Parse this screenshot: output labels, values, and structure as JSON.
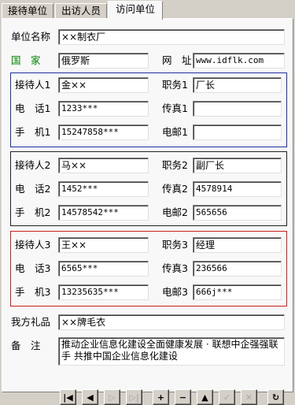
{
  "tabs": [
    {
      "label": "接待单位",
      "active": false
    },
    {
      "label": "出访人员",
      "active": false
    },
    {
      "label": "访问单位",
      "active": true
    }
  ],
  "form": {
    "unit_name": {
      "label": "单位名称",
      "value": "××制衣厂"
    },
    "country": {
      "label": "国　家",
      "value": "俄罗斯"
    },
    "website": {
      "label": "网　址",
      "value": "www.idflk.com"
    },
    "contacts": [
      {
        "name_label": "接待人1",
        "name": "金××",
        "title_label": "职务1",
        "title": "厂长",
        "phone_label": "电　话1",
        "phone": "1233***",
        "fax_label": "传真1",
        "fax": "",
        "mobile_label": "手　机1",
        "mobile": "15247858***",
        "email_label": "电邮1",
        "email": ""
      },
      {
        "name_label": "接待人2",
        "name": "马××",
        "title_label": "职务2",
        "title": "副厂长",
        "phone_label": "电　话2",
        "phone": "1452***",
        "fax_label": "传真2",
        "fax": "4578914",
        "mobile_label": "手　机2",
        "mobile": "14578542***",
        "email_label": "电邮2",
        "email": "565656"
      },
      {
        "name_label": "接待人3",
        "name": "王××",
        "title_label": "职务3",
        "title": "经理",
        "phone_label": "电　话3",
        "phone": "6565***",
        "fax_label": "传真3",
        "fax": "236566",
        "mobile_label": "手　机3",
        "mobile": "13235635***",
        "email_label": "电邮3",
        "email": "666j***"
      }
    ],
    "gift": {
      "label": "我方礼品",
      "value": "××牌毛衣"
    },
    "remark": {
      "label": "备　注",
      "value": "推动企业信息化建设全面健康发展 · 联想中企强强联手 共推中国企业信息化建设"
    }
  },
  "navigator": [
    {
      "name": "first",
      "glyph": "|◀",
      "enabled": true
    },
    {
      "name": "prior",
      "glyph": "◀",
      "enabled": true
    },
    {
      "name": "next",
      "glyph": "▷",
      "enabled": false
    },
    {
      "name": "last",
      "glyph": "▷|",
      "enabled": false
    },
    {
      "name": "insert",
      "glyph": "+",
      "enabled": true
    },
    {
      "name": "delete",
      "glyph": "−",
      "enabled": true
    },
    {
      "name": "edit",
      "glyph": "▲",
      "enabled": true
    },
    {
      "name": "post",
      "glyph": "✓",
      "enabled": false
    },
    {
      "name": "cancel",
      "glyph": "✕",
      "enabled": false
    },
    {
      "name": "refresh",
      "glyph": "↻",
      "enabled": true
    }
  ],
  "colors": {
    "group1_border": "#1a2fa0",
    "group2_border": "#202020",
    "group3_border": "#c8201c",
    "country_label": "#007f00"
  }
}
